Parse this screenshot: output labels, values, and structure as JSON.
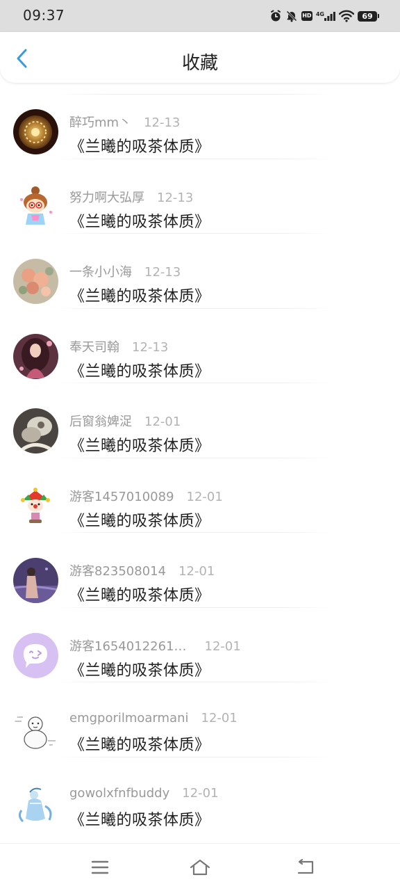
{
  "status_bar": {
    "time": "09:37",
    "network": "4G",
    "hd": "HD",
    "battery": "69",
    "icons": [
      "alarm-icon",
      "mute-icon",
      "hd-icon",
      "signal-icon",
      "wifi-icon",
      "battery-icon"
    ]
  },
  "header": {
    "title": "收藏",
    "back_icon": "chevron-left-icon"
  },
  "favorites": [
    {
      "user": "醉巧mm丶",
      "date": "12-13",
      "title": "《兰曦的吸茶体质》"
    },
    {
      "user": "努力啊大弘厚",
      "date": "12-13",
      "title": "《兰曦的吸茶体质》"
    },
    {
      "user": "一条小小海",
      "date": "12-13",
      "title": "《兰曦的吸茶体质》"
    },
    {
      "user": "奉天司翰",
      "date": "12-13",
      "title": "《兰曦的吸茶体质》"
    },
    {
      "user": "后窗翁婢浞",
      "date": "12-01",
      "title": "《兰曦的吸茶体质》"
    },
    {
      "user": "游客1457010089",
      "date": "12-01",
      "title": "《兰曦的吸茶体质》"
    },
    {
      "user": "游客823508014",
      "date": "12-01",
      "title": "《兰曦的吸茶体质》"
    },
    {
      "user": "游客1654012261…",
      "date": "12-01",
      "title": "《兰曦的吸茶体质》"
    },
    {
      "user": "emgporilmoarmani",
      "date": "12-01",
      "title": "《兰曦的吸茶体质》"
    },
    {
      "user": "gowolxfnfbuddy",
      "date": "12-01",
      "title": "《兰曦的吸茶体质》"
    }
  ],
  "nav_bar": {
    "icons": [
      "menu-icon",
      "home-icon",
      "back-icon"
    ]
  },
  "colors": {
    "accent": "#3a9ae0",
    "status_bar_bg": "#dedede",
    "username": "#999999",
    "title_text": "#1f1f1f"
  }
}
